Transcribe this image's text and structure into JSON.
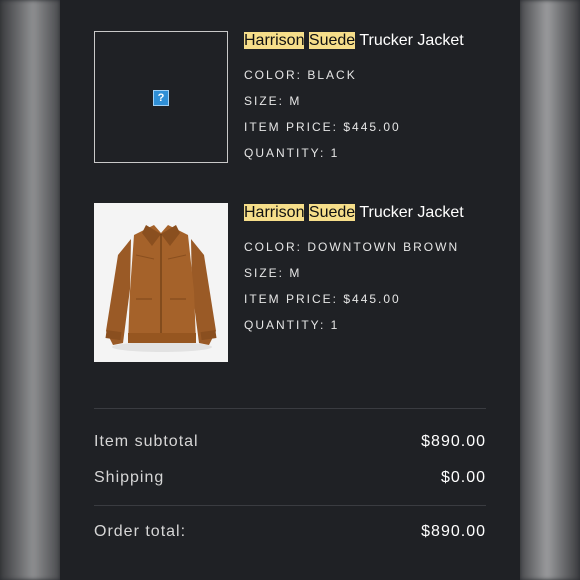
{
  "order": {
    "items": [
      {
        "title_highlight_1": "Harrison",
        "title_highlight_2": "Suede",
        "title_rest": "Trucker Jacket",
        "image": "broken-image",
        "color": "COLOR: BLACK",
        "size": "SIZE: M",
        "price": "ITEM PRICE: $445.00",
        "quantity": "QUANTITY: 1"
      },
      {
        "title_highlight_1": "Harrison",
        "title_highlight_2": "Suede",
        "title_rest": "Trucker Jacket",
        "image": "brown-suede-jacket-photo",
        "color": "COLOR: DOWNTOWN BROWN",
        "size": "SIZE: M",
        "price": "ITEM PRICE: $445.00",
        "quantity": "QUANTITY: 1"
      }
    ],
    "summary": {
      "subtotal_label": "Item subtotal",
      "subtotal_value": "$890.00",
      "shipping_label": "Shipping",
      "shipping_value": "$0.00",
      "total_label": "Order total:",
      "total_value": "$890.00"
    }
  },
  "colors": {
    "panel_bg": "#1f2125",
    "highlight": "#f6de8a",
    "jacket_brown": "#a5622a"
  }
}
